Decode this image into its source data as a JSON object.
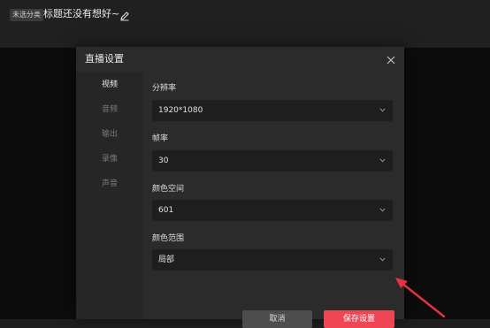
{
  "header": {
    "category_tag": "未选分类",
    "stream_title": "标题还没有想好~",
    "edit_icon": "pencil-icon"
  },
  "dialog": {
    "title": "直播设置",
    "close_icon": "close-icon",
    "nav": [
      {
        "label": "视频",
        "active": true
      },
      {
        "label": "音频",
        "active": false
      },
      {
        "label": "输出",
        "active": false
      },
      {
        "label": "录像",
        "active": false
      },
      {
        "label": "声音",
        "active": false
      }
    ],
    "fields": [
      {
        "label": "分辨率",
        "value": "1920*1080"
      },
      {
        "label": "帧率",
        "value": "30"
      },
      {
        "label": "颜色空间",
        "value": "601"
      },
      {
        "label": "颜色范围",
        "value": "局部"
      }
    ],
    "footer": {
      "cancel_label": "取消",
      "save_label": "保存设置"
    }
  },
  "colors": {
    "accent": "#ef4656",
    "arrow": "#e8323f",
    "dialog_bg": "#2b2b2b",
    "select_bg": "#1e1e1e"
  }
}
